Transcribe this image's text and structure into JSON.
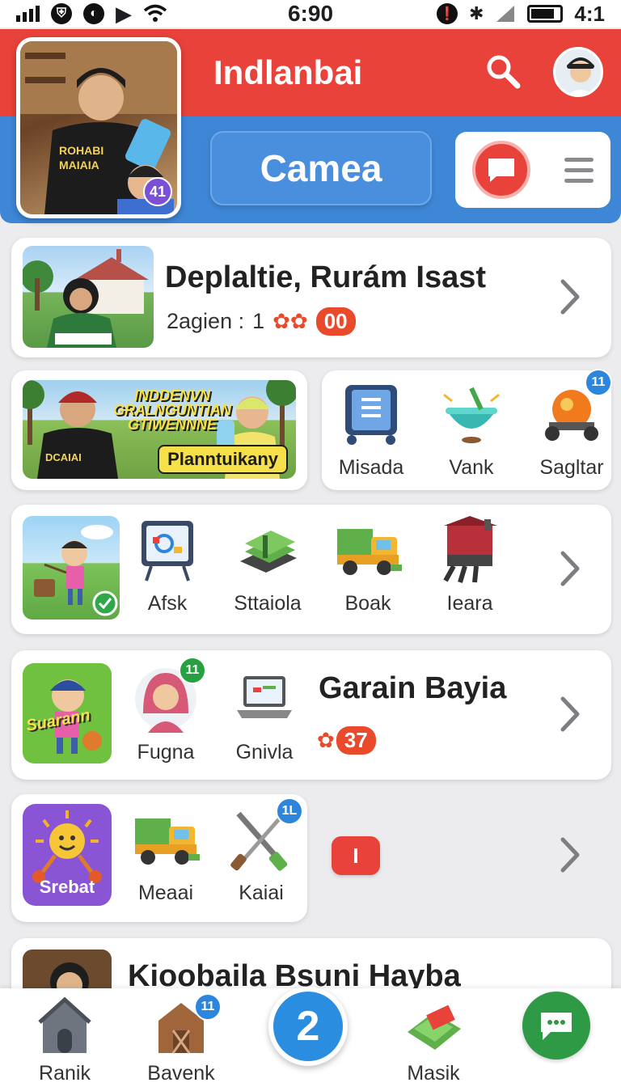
{
  "status_bar": {
    "time": "6:90",
    "battery_text": "4:1",
    "icons": [
      "signal-icon",
      "vpn-icon",
      "messenger-icon",
      "play-icon",
      "wifi-icon",
      "alarm-icon",
      "bluetooth-icon",
      "cell-signal-icon",
      "battery-icon"
    ]
  },
  "header": {
    "title": "Indlanbai",
    "primary_button": "Camea",
    "hero_badge": "41",
    "colors": {
      "top": "#e8423a",
      "bottom": "#3e86d6"
    }
  },
  "card1": {
    "title": "Deplaltie, Rurám Isast",
    "meta_label": "2agien :",
    "meta_value": "1",
    "points": "00"
  },
  "card2": {
    "banner_line1": "INDDENVN",
    "banner_line2": "GRALNGUNTIAN",
    "banner_line3": "GTIWENNNE",
    "banner_caption": "Planntuikany",
    "items": [
      {
        "label": "Misada",
        "icon": "tablet-icon"
      },
      {
        "label": "Vank",
        "icon": "bowl-icon"
      },
      {
        "label": "Sagltar",
        "icon": "cart-icon",
        "badge": "11"
      }
    ]
  },
  "card3": {
    "items": [
      {
        "label": "Afsk",
        "icon": "board-icon"
      },
      {
        "label": "Sttaiola",
        "icon": "stack-icon"
      },
      {
        "label": "Boak",
        "icon": "truck-icon"
      },
      {
        "label": "Ieara",
        "icon": "machine-icon"
      }
    ]
  },
  "card4": {
    "tile_text": "Suarann",
    "title": "Garain Bayia",
    "points": "37",
    "items": [
      {
        "label": "Fugna",
        "icon": "girl-avatar-icon",
        "badge": "11"
      },
      {
        "label": "Gnivla",
        "icon": "laptop-icon"
      }
    ]
  },
  "card5": {
    "tile_text": "Srebat",
    "alert_text": "I",
    "items": [
      {
        "label": "Meaai",
        "icon": "truck-icon"
      },
      {
        "label": "Kaiai",
        "icon": "tools-icon",
        "badge": "1L"
      }
    ]
  },
  "card6": {
    "title": "Kioobaila Bsuni Hayba"
  },
  "bottom_nav": {
    "items": [
      {
        "label": "Ranik",
        "icon": "house-icon"
      },
      {
        "label": "Bavenk",
        "icon": "barn-icon",
        "badge": "11"
      },
      {
        "label": "Masik",
        "icon": "mat-icon"
      }
    ],
    "center_number": "2"
  }
}
